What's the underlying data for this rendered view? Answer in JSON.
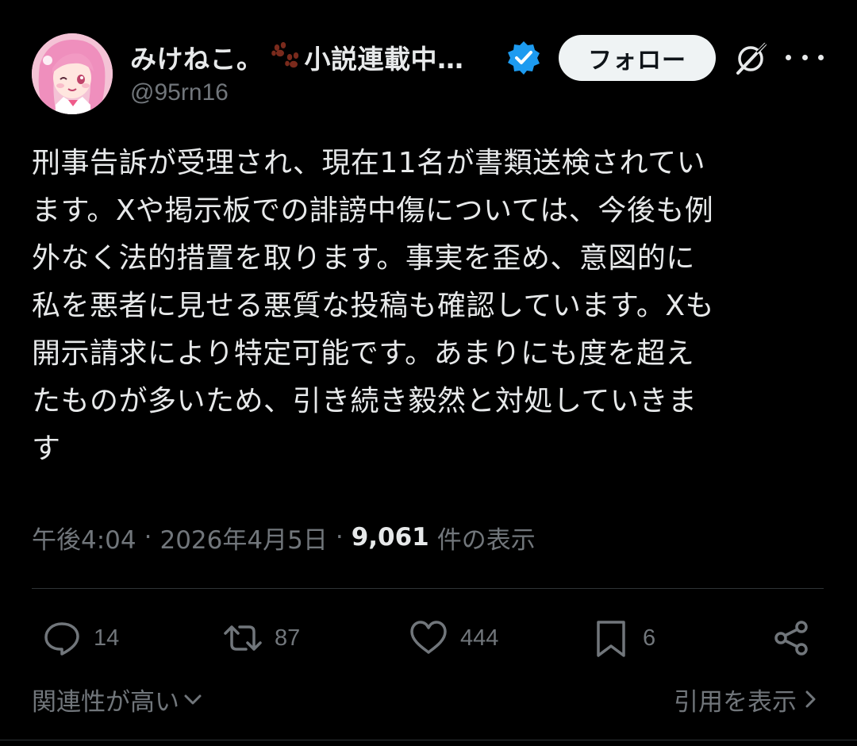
{
  "author": {
    "display_name": "みけねこ。🐾小説連載中…",
    "display_name_prefix": "みけねこ。",
    "display_name_suffix": "小説連載中…",
    "handle": "@95rn16",
    "verified": true,
    "avatar_icon": "anime-girl-avatar"
  },
  "header": {
    "follow_label": "フォロー",
    "grok_icon": "grok-icon",
    "more_icon": "more-options-icon"
  },
  "post": {
    "lines": [
      "刑事告訴が受理され、現在11名が書類送検されてい",
      "ます。Xや掲示板での誹謗中傷については、今後も例",
      "外なく法的措置を取ります。事実を歪め、意図的に",
      "私を悪者に見せる悪質な投稿も確認しています。Xも",
      "開示請求により特定可能です。あまりにも度を超え",
      "たものが多いため、引き続き毅然と対処していきま",
      "す"
    ]
  },
  "meta": {
    "time": "午後4:04",
    "separator": "·",
    "date": "2026年4月5日",
    "views_count": "9,061",
    "views_label": "件の表示"
  },
  "actions": {
    "replies": "14",
    "reposts": "87",
    "likes": "444",
    "bookmarks": "6"
  },
  "footer": {
    "sort_label": "関連性が高い",
    "quotes_label": "引用を表示"
  },
  "colors": {
    "background": "#000000",
    "text_primary": "#e7e9ea",
    "text_secondary": "#71767b",
    "verified_blue": "#1d9bf0",
    "divider": "#2f3336",
    "follow_bg": "#eff3f4",
    "paw_brown": "#7a2a1c"
  }
}
